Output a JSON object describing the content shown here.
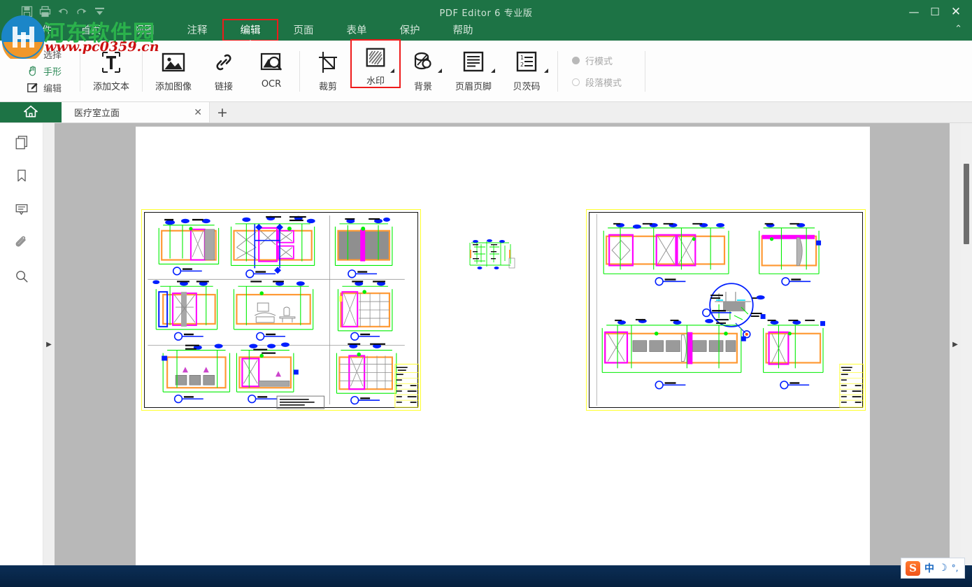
{
  "window": {
    "title": "PDF Editor 6 专业版",
    "minimize": "—",
    "maximize": "☐",
    "close": "✕",
    "collapse_ribbon": "⌃",
    "titlebar_color": "#1d7345"
  },
  "quick_access": [
    {
      "name": "save-icon",
      "label": "保存"
    },
    {
      "name": "print-icon",
      "label": "打印"
    },
    {
      "name": "undo-icon",
      "label": "撤销"
    },
    {
      "name": "redo-icon",
      "label": "重做"
    },
    {
      "name": "customize-qat-icon",
      "label": "自定义快速访问工具栏"
    }
  ],
  "watermark": {
    "site_cn": "河东软件园",
    "site_url": "www.pc0359.cn"
  },
  "tabs": [
    {
      "label": "文件",
      "active": false
    },
    {
      "label": "首页",
      "active": false
    },
    {
      "label": "视图",
      "active": false
    },
    {
      "label": "注释",
      "active": false
    },
    {
      "label": "编辑",
      "active": true
    },
    {
      "label": "页面",
      "active": false
    },
    {
      "label": "表单",
      "active": false
    },
    {
      "label": "保护",
      "active": false
    },
    {
      "label": "帮助",
      "active": false
    }
  ],
  "ribbon": {
    "modes": [
      {
        "label": "选择",
        "icon": "cursor-select-icon",
        "selected": false
      },
      {
        "label": "手形",
        "icon": "hand-tool-icon",
        "selected": true
      },
      {
        "label": "编辑",
        "icon": "edit-pencil-icon",
        "selected": false
      }
    ],
    "tools": [
      {
        "label": "添加文本",
        "icon": "add-text-icon",
        "has_dropdown": false,
        "highlighted": false
      },
      {
        "label": "添加图像",
        "icon": "add-image-icon",
        "has_dropdown": false,
        "highlighted": false
      },
      {
        "label": "链接",
        "icon": "link-icon",
        "has_dropdown": false,
        "highlighted": false
      },
      {
        "label": "OCR",
        "icon": "ocr-icon",
        "has_dropdown": false,
        "highlighted": false
      },
      {
        "label": "裁剪",
        "icon": "crop-icon",
        "has_dropdown": false,
        "highlighted": false
      },
      {
        "label": "水印",
        "icon": "watermark-icon",
        "has_dropdown": true,
        "highlighted": true
      },
      {
        "label": "背景",
        "icon": "background-icon",
        "has_dropdown": true,
        "highlighted": false
      },
      {
        "label": "页眉页脚",
        "icon": "header-footer-icon",
        "has_dropdown": true,
        "highlighted": false
      },
      {
        "label": "贝茨码",
        "icon": "bates-numbering-icon",
        "has_dropdown": true,
        "highlighted": false
      }
    ],
    "text_modes": [
      {
        "label": "行模式",
        "selected": true
      },
      {
        "label": "段落模式",
        "selected": false
      }
    ],
    "highlight_color": "#ee1b1b"
  },
  "doctabs": {
    "home_icon": "home-icon",
    "open_documents": [
      {
        "title": "医疗室立面",
        "close_label": "✕",
        "active": true
      }
    ],
    "new_tab_label": "+"
  },
  "sidebar": {
    "items": [
      {
        "name": "page-thumbnails-icon",
        "label": "页面缩略图"
      },
      {
        "name": "bookmark-icon",
        "label": "书签"
      },
      {
        "name": "comment-icon",
        "label": "注释"
      },
      {
        "name": "attachment-icon",
        "label": "附件"
      },
      {
        "name": "search-icon",
        "label": "搜索"
      }
    ],
    "expand_left_label": "▶",
    "expand_right_label": "▶"
  },
  "viewer": {
    "background_color": "#b8b8b8",
    "page_color": "#ffffff",
    "drawings": [
      {
        "name": "cad-sheet-left",
        "caption": "医疗室立面图 - 图纸一"
      },
      {
        "name": "cad-thumbnail-middle",
        "caption": "缩略图"
      },
      {
        "name": "cad-sheet-right",
        "caption": "医疗室立面图 - 图纸二"
      }
    ]
  },
  "ime": {
    "logo": "S",
    "mode": "中",
    "moon": "☽",
    "punctuation": "°,"
  }
}
